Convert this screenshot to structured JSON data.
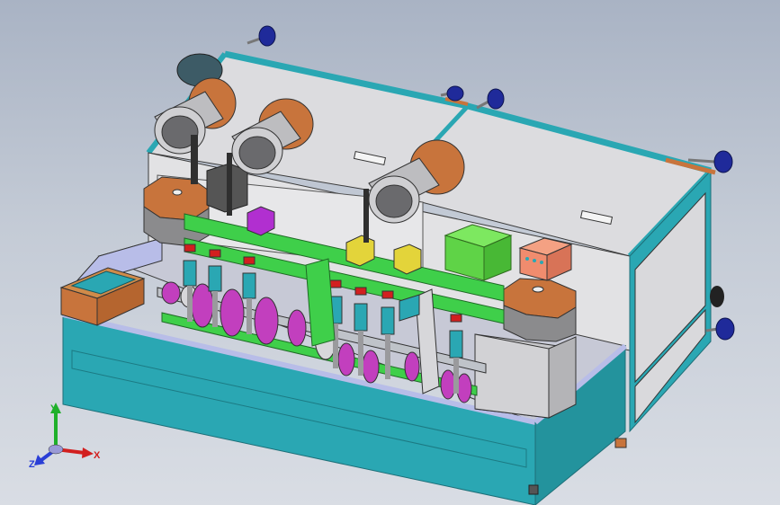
{
  "viewport": {
    "background_top": "#a9b3c4",
    "background_bottom": "#d9dde4"
  },
  "model": {
    "frame_color": "#2aa7b3",
    "panel_color": "#d7d7da",
    "board_color": "#3fcf4a",
    "accent_orange": "#c8743c",
    "knob_color": "#1f2a9a",
    "wheel_color": "#c23fbe"
  },
  "triad": {
    "x_label": "X",
    "y_label": "Y",
    "z_label": "Z",
    "x_color": "#d21f1f",
    "y_color": "#1fb02a",
    "z_color": "#2a3fd6"
  }
}
